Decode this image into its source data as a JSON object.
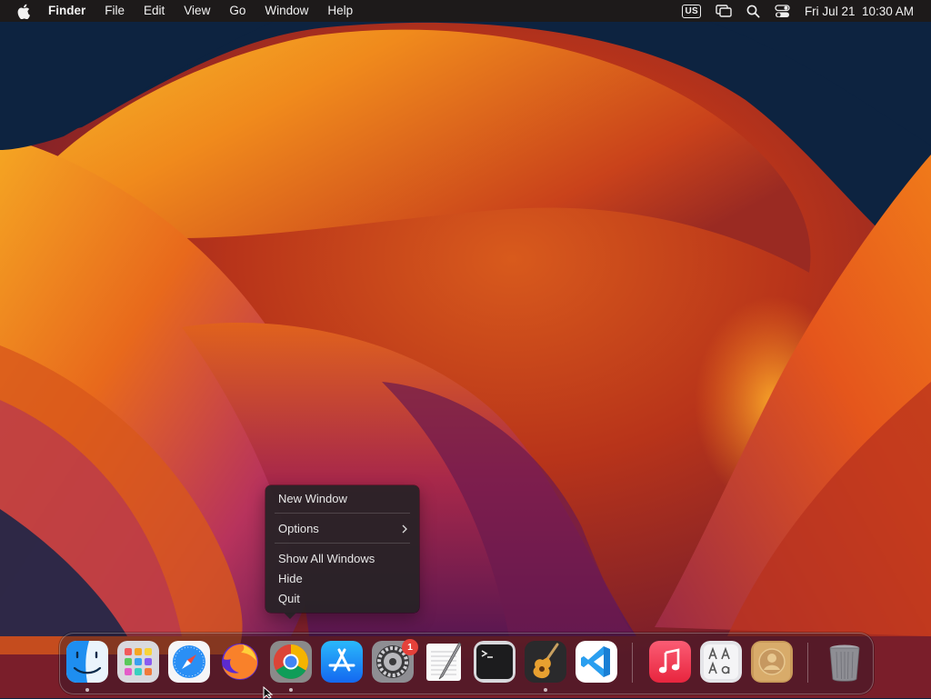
{
  "menubar": {
    "app_name": "Finder",
    "menus": [
      "File",
      "Edit",
      "View",
      "Go",
      "Window",
      "Help"
    ],
    "status": {
      "input_source": "US",
      "icons": [
        "screen-mirroring-icon",
        "spotlight-search-icon",
        "control-center-icon"
      ],
      "clock": "Fri Jul 21  10:30 AM"
    }
  },
  "context_menu": {
    "items": [
      {
        "label": "New Window"
      },
      {
        "label": "Options",
        "submenu": true
      },
      {
        "label": "Show All Windows"
      },
      {
        "label": "Hide"
      },
      {
        "label": "Quit"
      }
    ]
  },
  "dock": {
    "apps": [
      {
        "icon": "finder-icon",
        "running": true
      },
      {
        "icon": "launchpad-icon",
        "running": false
      },
      {
        "icon": "safari-icon",
        "running": false
      },
      {
        "icon": "firefox-icon",
        "running": false
      },
      {
        "icon": "chrome-icon",
        "running": true
      },
      {
        "icon": "app-store-icon",
        "running": false
      },
      {
        "icon": "system-settings-icon",
        "running": false,
        "badge": "1"
      },
      {
        "icon": "textedit-icon",
        "running": false
      },
      {
        "icon": "terminal-icon",
        "running": false
      },
      {
        "icon": "garageband-icon",
        "running": true
      },
      {
        "icon": "vscode-icon",
        "running": false
      },
      {
        "icon": "music-icon",
        "running": false
      },
      {
        "icon": "font-book-icon",
        "running": false
      },
      {
        "icon": "contacts-icon",
        "running": false
      },
      {
        "icon": "trash-icon",
        "running": false
      }
    ]
  },
  "colors": {
    "menubar_bg": "#1d1a1a",
    "wallpaper_navy": "#0d2340",
    "wallpaper_orange": "#f08a1c",
    "badge_red": "#e5413a"
  }
}
